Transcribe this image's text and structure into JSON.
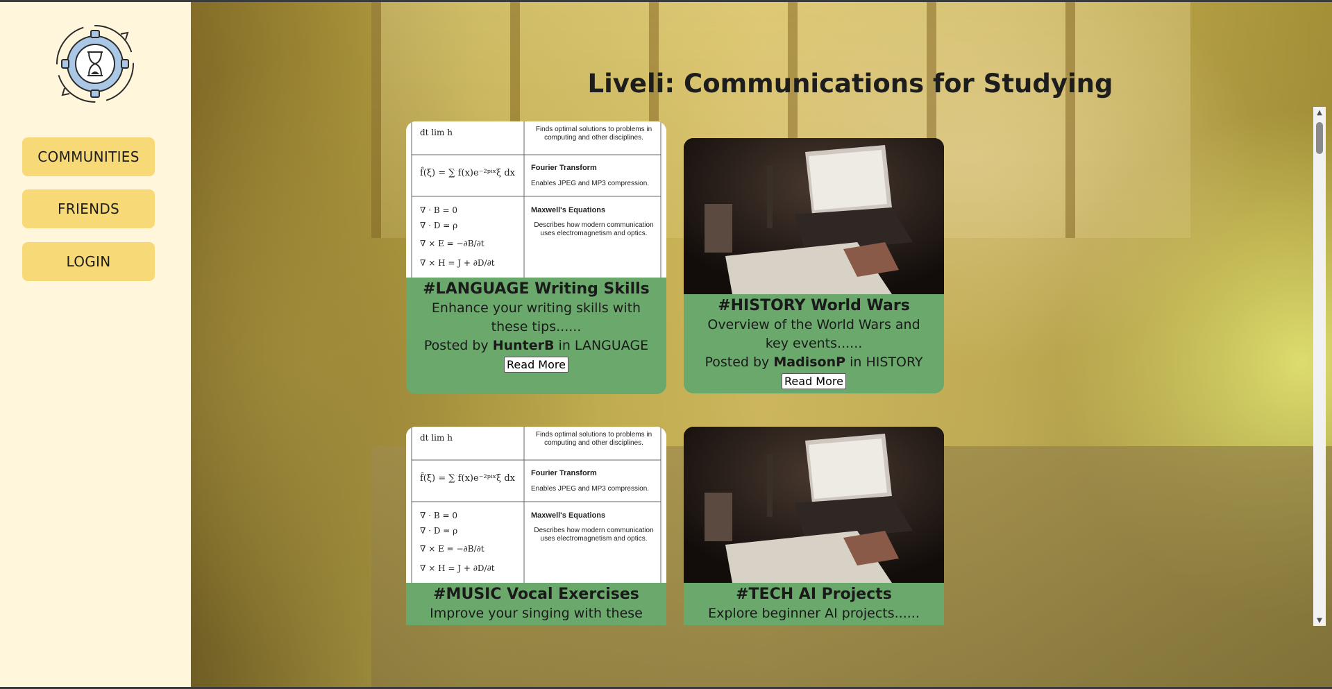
{
  "app_title": "Liveli: Communications for Studying",
  "sidebar": {
    "logo_icon": "hourglass-gear-icon",
    "items": [
      {
        "label": "COMMUNITIES"
      },
      {
        "label": "FRIENDS"
      },
      {
        "label": "LOGIN"
      }
    ]
  },
  "posts": [
    {
      "title": "#LANGUAGE Writing Skills",
      "description": "Enhance your writing skills with these tips......",
      "posted_by_prefix": "Posted by",
      "author": "HunterB",
      "in_word": "in",
      "community": "LANGUAGE",
      "button": "Read More",
      "thumb": {
        "row1": "Finds optimal solutions to problems in computing and other disciplines.",
        "row2_title": "Fourier Transform",
        "row2": "Enables JPEG and MP3 compression.",
        "row3_title": "Maxwell's Equations",
        "row3": "Describes how modern communication uses electromagnetism and optics."
      }
    },
    {
      "title": "#HISTORY World Wars",
      "description": "Overview of the World Wars and key events......",
      "posted_by_prefix": "Posted by",
      "author": "MadisonP",
      "in_word": "in",
      "community": "HISTORY",
      "button": "Read More"
    },
    {
      "title": "#MUSIC Vocal Exercises",
      "description": "Improve your singing with these",
      "thumb": {
        "row1": "Finds optimal solutions to problems in computing and other disciplines.",
        "row2_title": "Fourier Transform",
        "row2": "Enables JPEG and MP3 compression.",
        "row3_title": "Maxwell's Equations",
        "row3": "Describes how modern communication uses electromagnetism and optics."
      }
    },
    {
      "title": "#TECH AI Projects",
      "description": "Explore beginner AI projects......"
    }
  ],
  "colors": {
    "sidebar_bg": "#fff6dc",
    "nav_button": "#f7d978",
    "card_bg": "#6aa86c"
  }
}
